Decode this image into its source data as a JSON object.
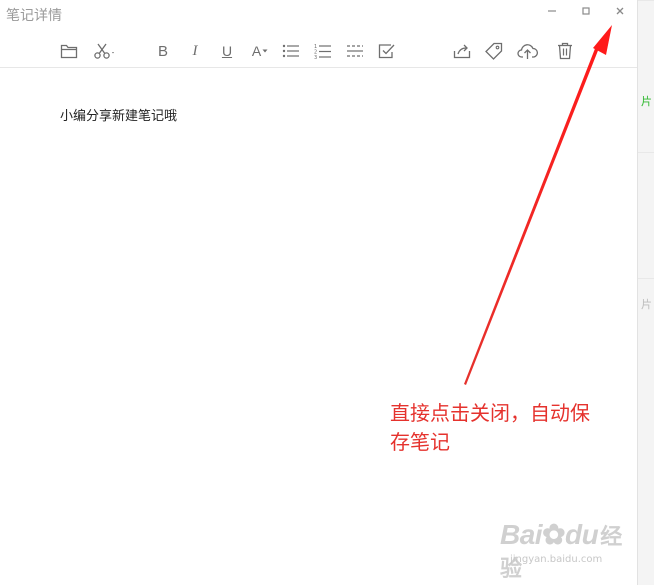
{
  "window": {
    "title": "笔记详情"
  },
  "window_controls": [
    "minimize",
    "maximize",
    "close"
  ],
  "toolbar": {
    "left_tools": [
      "folder-icon",
      "scissors-icon",
      "bold-icon",
      "italic-icon",
      "underline-icon",
      "font-size-icon",
      "bulleted-list-icon",
      "numbered-list-icon",
      "divider-icon",
      "checkbox-icon"
    ],
    "right_tools": [
      "share-icon",
      "tag-icon",
      "cloud-upload-icon",
      "trash-icon"
    ],
    "bold_label": "B",
    "italic_label": "I",
    "underline_label": "U",
    "font_size_label": "A"
  },
  "note": {
    "content": "小编分享新建笔记哦"
  },
  "annotation": {
    "line1": "直接点击关闭，自动保",
    "line2": "存笔记",
    "color": "#e5322d"
  },
  "right_strip": {
    "glyph1": "片",
    "glyph2": "片"
  },
  "watermark": {
    "logo": "Bai",
    "logo_end": "du",
    "cn": "经验",
    "url": "jingyan.baidu.com"
  }
}
